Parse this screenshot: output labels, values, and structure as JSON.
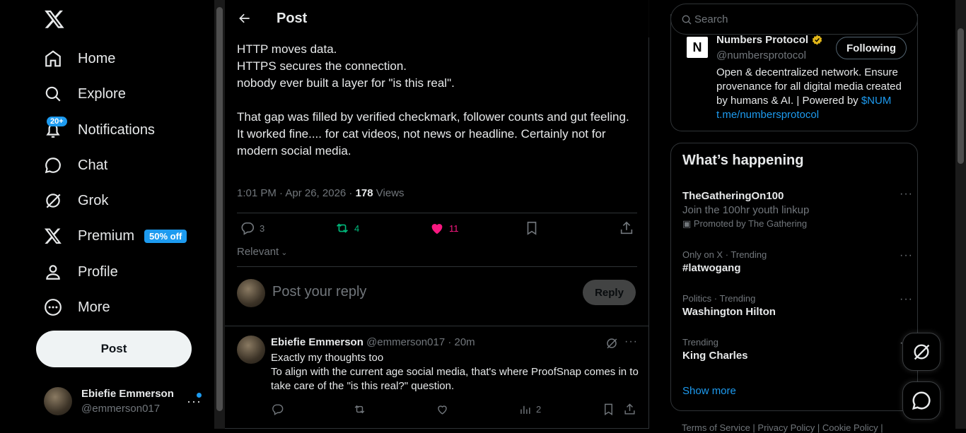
{
  "sidebar": {
    "logo": "x-logo-icon",
    "items": [
      {
        "label": "Home",
        "icon": "home-icon"
      },
      {
        "label": "Explore",
        "icon": "search-icon"
      },
      {
        "label": "Notifications",
        "icon": "bell-icon",
        "badge": "20+"
      },
      {
        "label": "Chat",
        "icon": "chat-icon"
      },
      {
        "label": "Grok",
        "icon": "grok-icon"
      },
      {
        "label": "Premium",
        "icon": "x-icon",
        "badge": "50% off"
      },
      {
        "label": "Profile",
        "icon": "person-icon"
      },
      {
        "label": "More",
        "icon": "more-circle-icon"
      }
    ],
    "post_button": "Post",
    "account": {
      "name": "Ebiefie Emmerson",
      "handle": "@emmerson017"
    }
  },
  "main": {
    "header_title": "Post",
    "post_text": [
      "HTTP moves data.",
      "HTTPS secures the connection.",
      "nobody ever built a layer for \"is this real\".",
      "",
      "That gap was filled by verified checkmark, follower counts and gut feeling.",
      "It worked fine.... for cat videos, not news or headline. Certainly not for modern social media."
    ],
    "meta": {
      "time": "1:01 PM · Apr 26, 2026 · ",
      "views_count": "178",
      "views_label": " Views"
    },
    "actions": {
      "replies": "3",
      "reposts": "4",
      "likes": "11"
    },
    "sort_label": "Relevant",
    "reply_placeholder": "Post your reply",
    "reply_button": "Reply",
    "reply": {
      "name": "Ebiefie Emmerson",
      "handle": "@emmerson017 · 20m",
      "line1": "Exactly my thoughts too",
      "line2": "To align with the current age social media, that's where ProofSnap comes in to take care of the \"is this real?\" question.",
      "views": "2"
    }
  },
  "right": {
    "search_placeholder": "Search",
    "profile_card": {
      "name": "Numbers Protocol",
      "handle": "@numbersprotocol",
      "follow_label": "Following",
      "bio": "Open & decentralized network. Ensure provenance for all digital media created by humans & AI. | Powered by ",
      "bio_link1": "$NUM",
      "bio_link2": "t.me/numbersprotocol"
    },
    "whats_happening": {
      "title": "What’s happening",
      "trends": [
        {
          "name": "TheGatheringOn100",
          "sub": "Join the 100hr youth linkup",
          "promo": "Promoted by The Gathering"
        },
        {
          "context": "Only on X · Trending",
          "name": "#latwogang"
        },
        {
          "context": "Politics · Trending",
          "name": "Washington Hilton"
        },
        {
          "context": "Trending",
          "name": "King Charles"
        }
      ],
      "show_more": "Show more"
    },
    "footer": "Terms of Service  |  Privacy Policy  |  Cookie Policy  |"
  },
  "colors": {
    "accent": "#1d9bf0",
    "repost": "#00ba7c",
    "like": "#f91880"
  }
}
